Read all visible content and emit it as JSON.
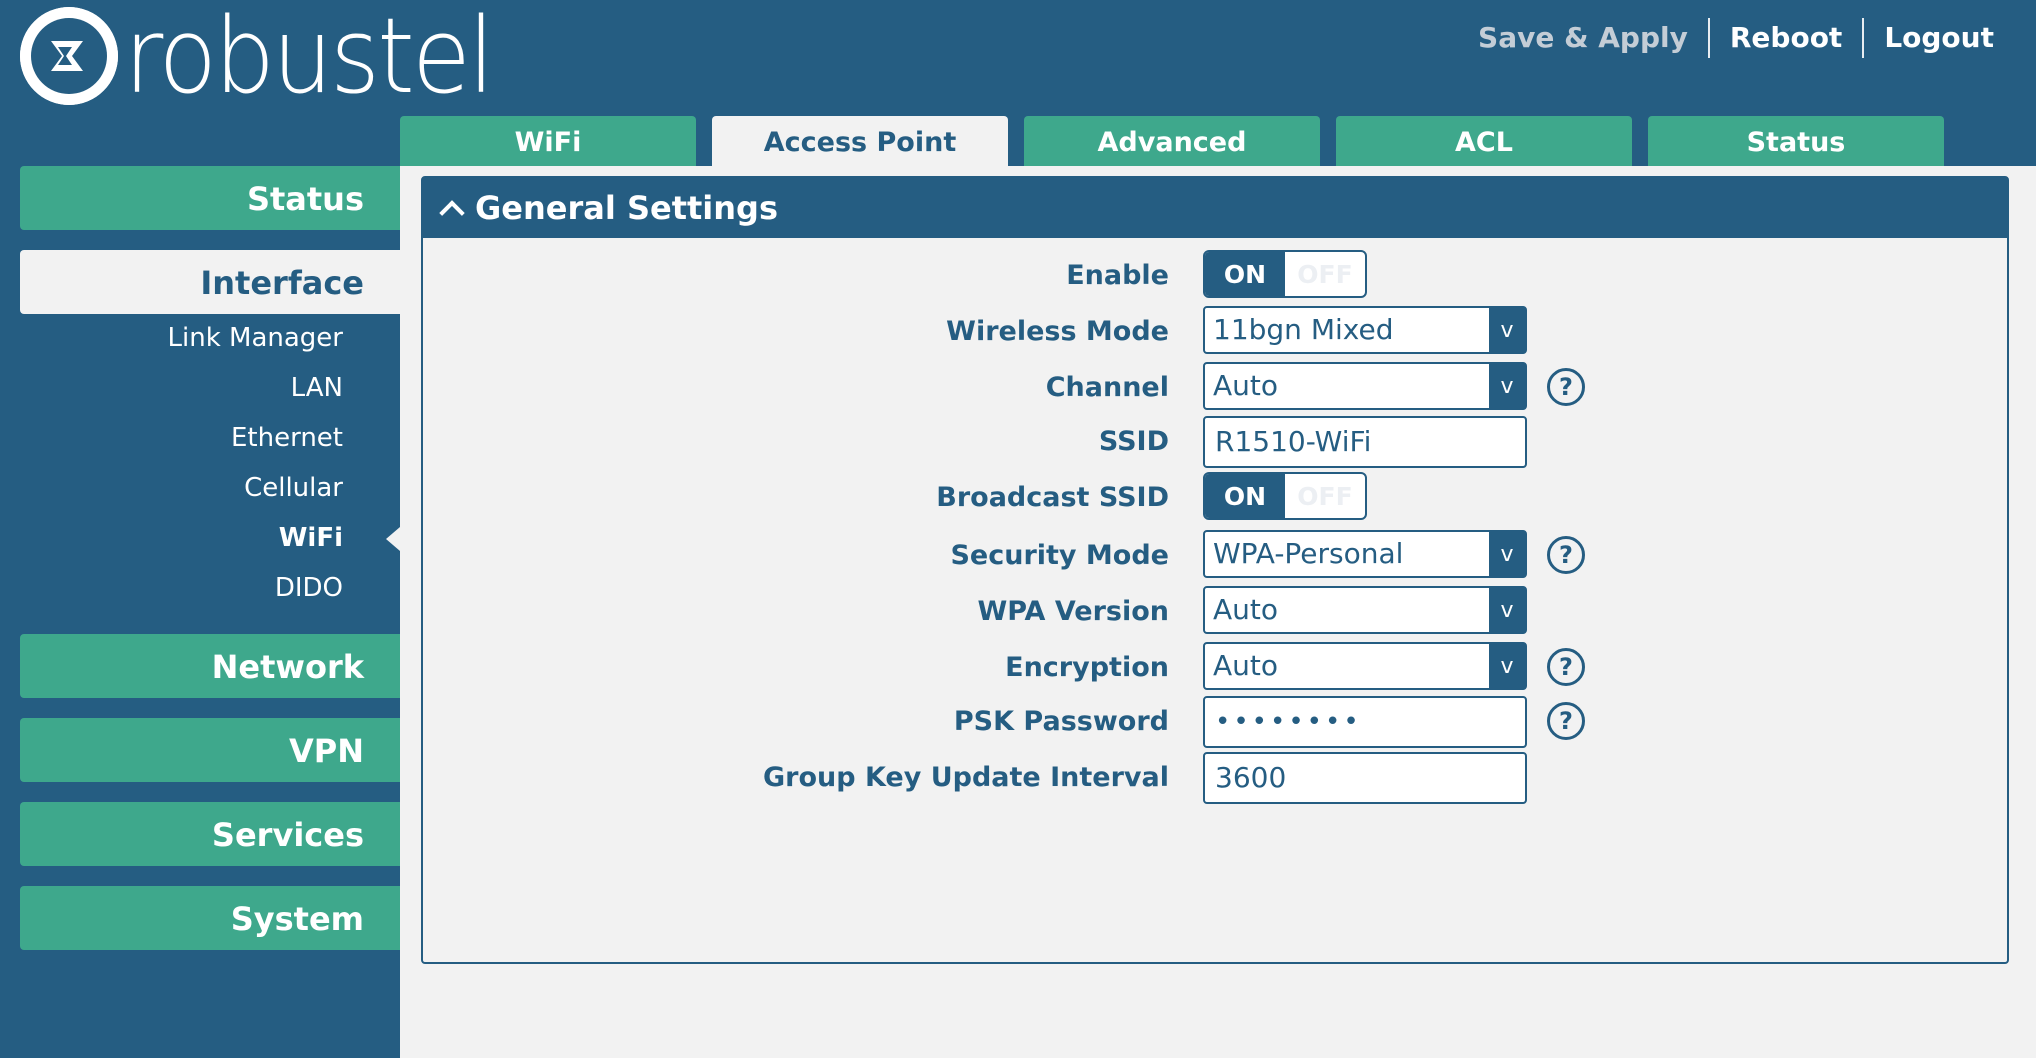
{
  "brand": {
    "name": "robustel",
    "logo_mark": "R"
  },
  "header_links": [
    {
      "label": "Save & Apply"
    },
    {
      "label": "Reboot"
    },
    {
      "label": "Logout"
    }
  ],
  "tabs": [
    {
      "label": "WiFi"
    },
    {
      "label": "Access Point"
    },
    {
      "label": "Advanced"
    },
    {
      "label": "ACL"
    },
    {
      "label": "Status"
    }
  ],
  "sidebar": {
    "status": "Status",
    "interface": "Interface",
    "sub_items": [
      {
        "label": "Link Manager"
      },
      {
        "label": "LAN"
      },
      {
        "label": "Ethernet"
      },
      {
        "label": "Cellular"
      },
      {
        "label": "WiFi"
      },
      {
        "label": "DIDO"
      }
    ],
    "network": "Network",
    "vpn": "VPN",
    "services": "Services",
    "system": "System"
  },
  "panel": {
    "title": "General Settings",
    "fields": {
      "enable": {
        "label": "Enable",
        "on": "ON",
        "off": "OFF"
      },
      "wireless_mode": {
        "label": "Wireless Mode",
        "value": "11bgn Mixed"
      },
      "channel": {
        "label": "Channel",
        "value": "Auto"
      },
      "ssid": {
        "label": "SSID",
        "value": "R1510-WiFi"
      },
      "broadcast_ssid": {
        "label": "Broadcast SSID",
        "on": "ON",
        "off": "OFF"
      },
      "security_mode": {
        "label": "Security Mode",
        "value": "WPA-Personal"
      },
      "wpa_version": {
        "label": "WPA Version",
        "value": "Auto"
      },
      "encryption": {
        "label": "Encryption",
        "value": "Auto"
      },
      "psk_password": {
        "label": "PSK Password",
        "value": "••••••••"
      },
      "group_key_interval": {
        "label": "Group Key Update Interval",
        "value": "3600"
      }
    },
    "dropdown_arrow": "v",
    "help_glyph": "?"
  },
  "icons": {
    "collapse": "chevron-up-icon",
    "help": "help-icon",
    "dropdown": "dropdown-arrow-icon"
  },
  "colors": {
    "primary": "#255d82",
    "accent": "#3ea88c",
    "panel_bg": "#f2f2f2"
  }
}
